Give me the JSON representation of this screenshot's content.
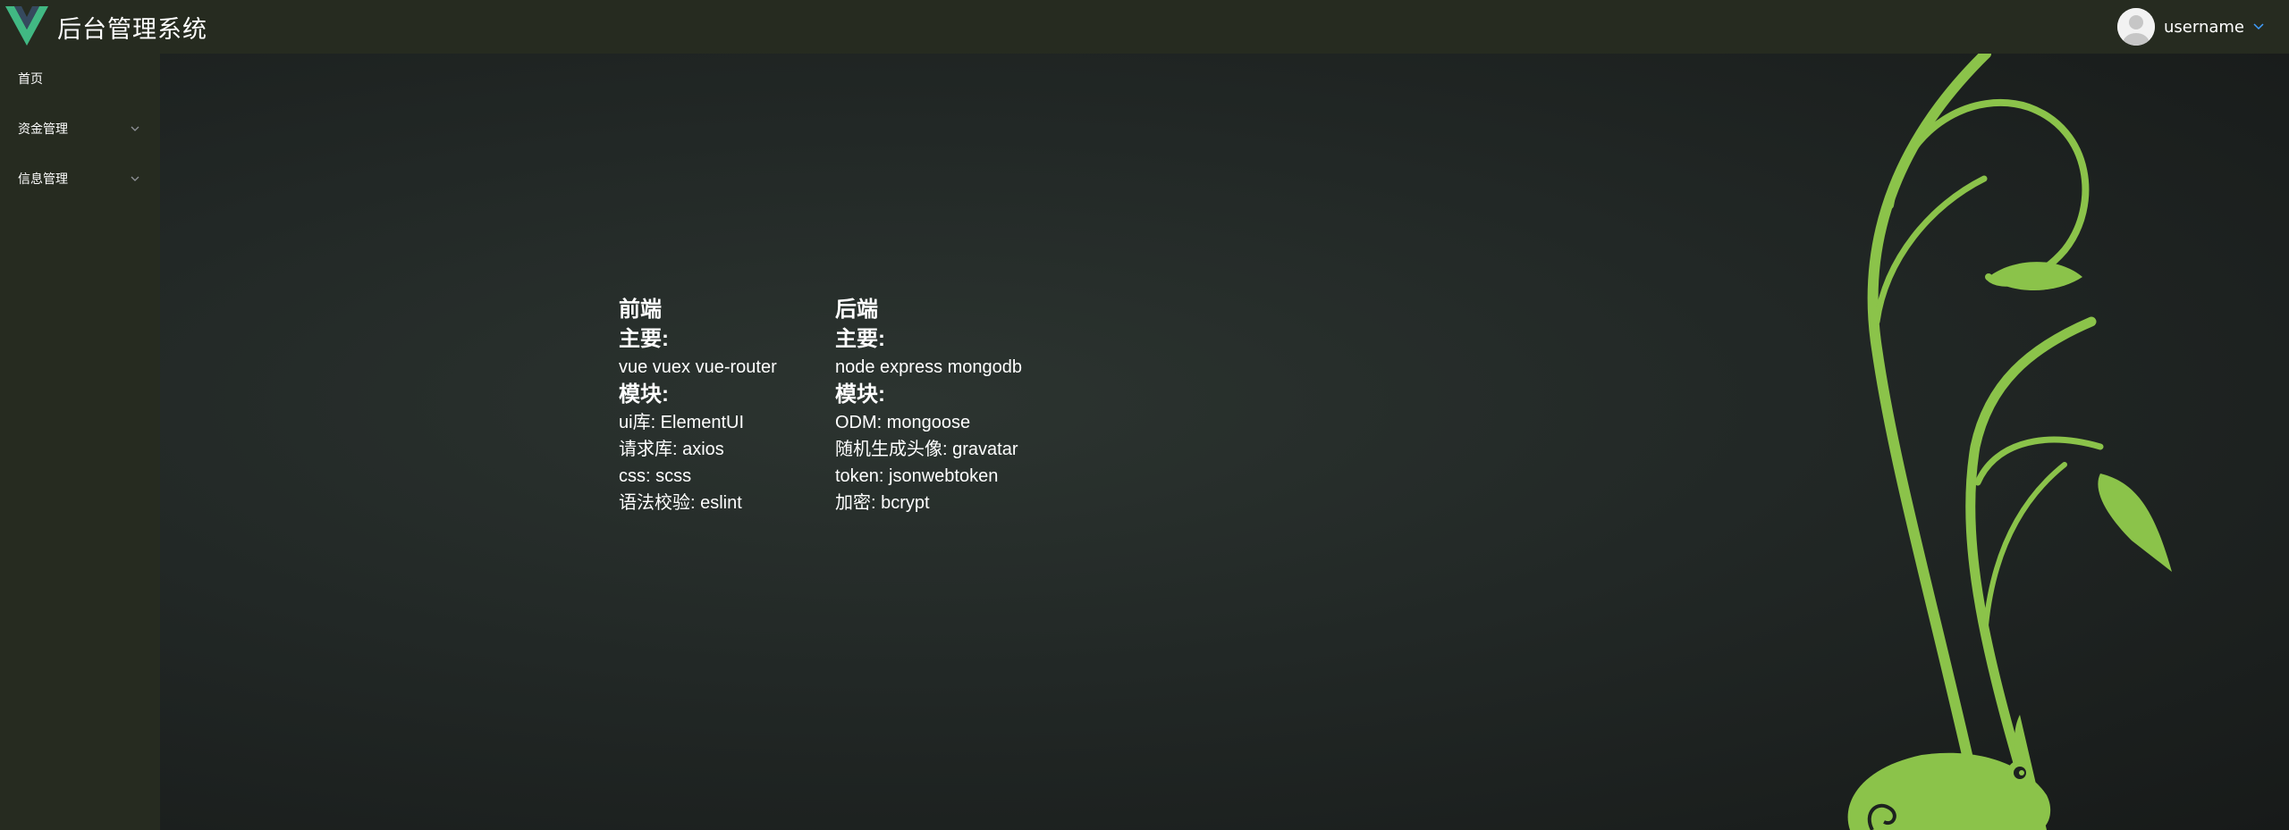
{
  "header": {
    "title": "后台管理系统",
    "logo_icon": "vue-logo-icon",
    "user": {
      "name": "username",
      "avatar_icon": "user-avatar-icon",
      "menu_icon": "chevron-down-icon"
    }
  },
  "sidebar": {
    "items": [
      {
        "label": "首页",
        "has_children": false
      },
      {
        "label": "资金管理",
        "has_children": true
      },
      {
        "label": "信息管理",
        "has_children": true
      }
    ]
  },
  "content": {
    "frontend": {
      "title": "前端",
      "main_heading": "主要:",
      "main_text": "vue vuex vue-router",
      "modules_heading": "模块:",
      "modules": [
        "ui库: ElementUI",
        "请求库: axios",
        "css: scss",
        "语法校验: eslint"
      ]
    },
    "backend": {
      "title": "后端",
      "main_heading": "主要:",
      "main_text": "node express mongodb",
      "modules_heading": "模块:",
      "modules": [
        "ODM: mongoose",
        "随机生成头像: gravatar",
        "token: jsonwebtoken",
        "加密: bcrypt"
      ]
    }
  },
  "colors": {
    "topbar_bg": "#262b20",
    "sidebar_bg": "#262b20",
    "vue_green": "#41b883",
    "vue_dark": "#35495e",
    "leaf_green": "#8bc34a"
  }
}
